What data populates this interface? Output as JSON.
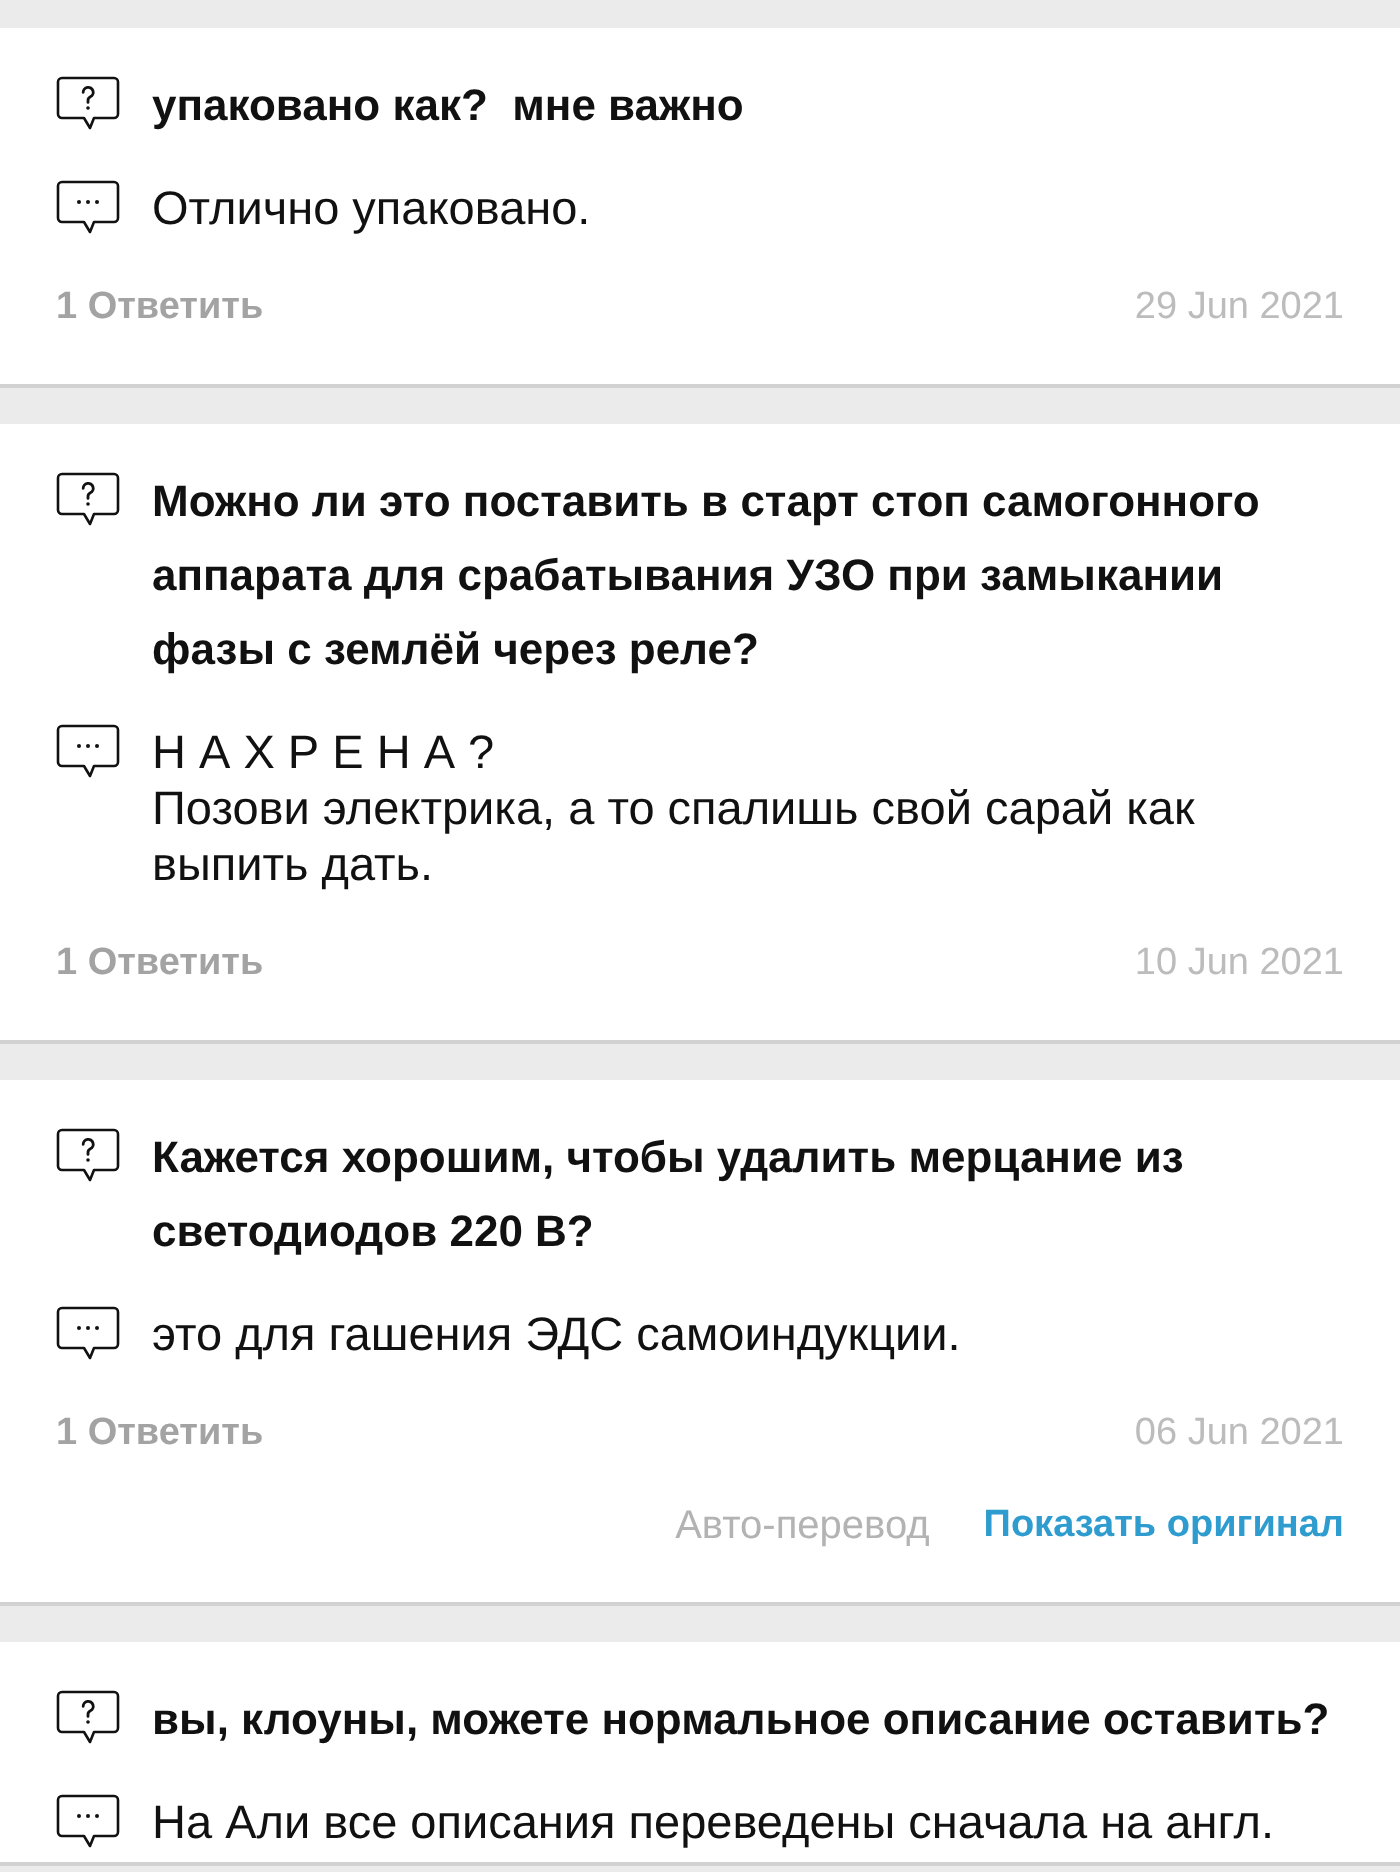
{
  "qa_items": [
    {
      "question": "упаковано как?  мне важно",
      "answer": "Отлично упаковано.",
      "reply_link": "1 Ответить",
      "date": "29 Jun 2021"
    },
    {
      "question": "Можно ли это поставить в старт стоп самогонного аппарата для срабатывания УЗО при замыкании фазы с землёй через реле?",
      "answer": "Н А Х Р Е Н А ?\nПозови электрика, а то спалишь свой сарай как выпить дать.",
      "reply_link": "1 Ответить",
      "date": "10 Jun 2021"
    },
    {
      "question": "Кажется хорошим, чтобы удалить мерцание из светодиодов 220 В?",
      "answer": "это для гашения ЭДС самоиндукции.",
      "reply_link": "1 Ответить",
      "date": "06 Jun 2021",
      "translation": {
        "label": "Авто-перевод",
        "action": "Показать оригинал"
      }
    },
    {
      "question": "вы, клоуны, можете нормальное описание оставить?",
      "answer": "На Али все описания переведены сначала на англ."
    }
  ]
}
